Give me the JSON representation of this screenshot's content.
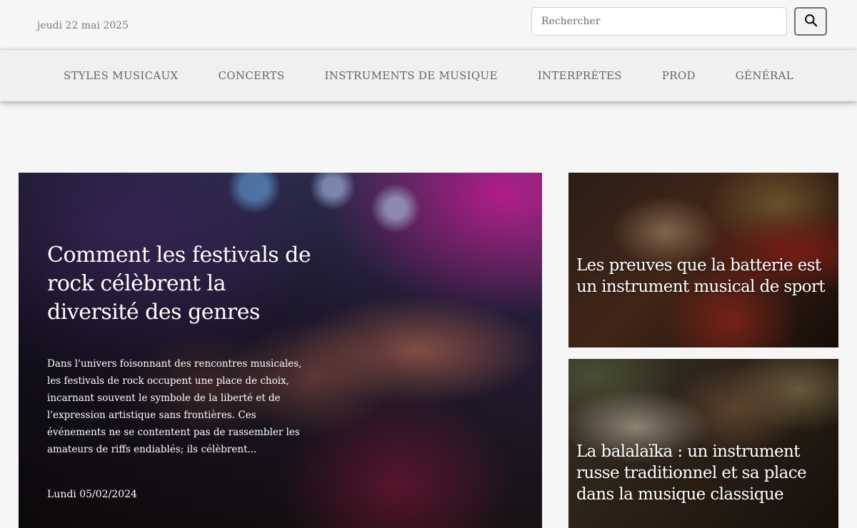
{
  "header": {
    "date": "jeudi 22 mai 2025",
    "search": {
      "placeholder": "Rechercher",
      "button_icon": "search-icon"
    }
  },
  "nav": {
    "items": [
      {
        "label": "STYLES MUSICAUX"
      },
      {
        "label": "CONCERTS"
      },
      {
        "label": "INSTRUMENTS DE MUSIQUE"
      },
      {
        "label": "INTERPRÈTES"
      },
      {
        "label": "PROD"
      },
      {
        "label": "GÉNÉRAL"
      }
    ]
  },
  "featured": {
    "title": "Comment les festivals de rock célèbrent la diversité des genres",
    "excerpt": "Dans l'univers foisonnant des rencontres musicales, les festivals de rock occupent une place de choix, incarnant souvent le symbole de la liberté et de l'expression artistique sans frontières. Ces événements ne se contentent pas de rassembler les amateurs de riffs endiablés; ils célèbrent...",
    "date": "Lundi 05/02/2024"
  },
  "side_articles": [
    {
      "title": "Les preuves que la batterie est un instrument musical de sport"
    },
    {
      "title": "La balalaïka : un instrument russe traditionnel et sa place dans la musique classique"
    }
  ]
}
